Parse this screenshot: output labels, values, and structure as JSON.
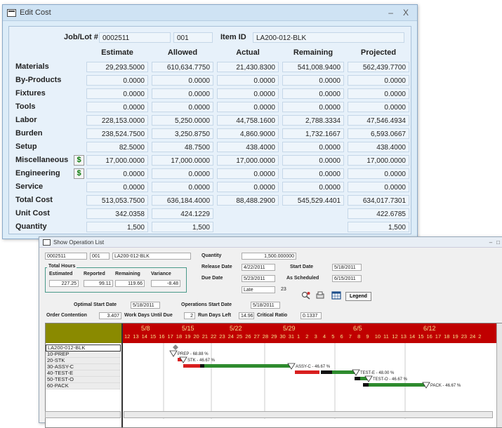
{
  "edit_cost": {
    "title": "Edit Cost",
    "minimize": "–",
    "close": "X",
    "job_lot_label": "Job/Lot #",
    "job": "0002511",
    "lot": "001",
    "item_id_label": "Item ID",
    "item_id": "LA200-012-BLK",
    "columns": [
      "Estimate",
      "Allowed",
      "Actual",
      "Remaining",
      "Projected"
    ],
    "rows": [
      {
        "label": "Materials",
        "values": [
          "29,293.5000",
          "610,634.7750",
          "21,430.8300",
          "541,008.9400",
          "562,439.7700"
        ]
      },
      {
        "label": "By-Products",
        "values": [
          "0.0000",
          "0.0000",
          "0.0000",
          "0.0000",
          "0.0000"
        ]
      },
      {
        "label": "Fixtures",
        "values": [
          "0.0000",
          "0.0000",
          "0.0000",
          "0.0000",
          "0.0000"
        ]
      },
      {
        "label": "Tools",
        "values": [
          "0.0000",
          "0.0000",
          "0.0000",
          "0.0000",
          "0.0000"
        ]
      },
      {
        "label": "Labor",
        "values": [
          "228,153.0000",
          "5,250.0000",
          "44,758.1600",
          "2,788.3334",
          "47,546.4934"
        ]
      },
      {
        "label": "Burden",
        "values": [
          "238,524.7500",
          "3,250.8750",
          "4,860.9000",
          "1,732.1667",
          "6,593.0667"
        ]
      },
      {
        "label": "Setup",
        "values": [
          "82.5000",
          "48.7500",
          "438.4000",
          "0.0000",
          "438.4000"
        ]
      },
      {
        "label": "Miscellaneous",
        "values": [
          "17,000.0000",
          "17,000.0000",
          "17,000.0000",
          "0.0000",
          "17,000.0000"
        ],
        "dollar": true
      },
      {
        "label": "Engineering",
        "values": [
          "0.0000",
          "0.0000",
          "0.0000",
          "0.0000",
          "0.0000"
        ],
        "dollar": true
      },
      {
        "label": "Service",
        "values": [
          "0.0000",
          "0.0000",
          "0.0000",
          "0.0000",
          "0.0000"
        ]
      },
      {
        "label": "Total Cost",
        "values": [
          "513,053.7500",
          "636,184.4000",
          "88,488.2900",
          "545,529.4401",
          "634,017.7301"
        ]
      },
      {
        "label": "Unit Cost",
        "values": [
          "342.0358",
          "424.1229",
          "",
          "",
          "422.6785"
        ]
      },
      {
        "label": "Quantity",
        "values": [
          "1,500",
          "1,500",
          "",
          "",
          "1,500"
        ]
      }
    ],
    "dollar_symbol": "$"
  },
  "operation_list": {
    "title": "Show Operation List",
    "minimize": "–",
    "restore": "□",
    "job": "0002511",
    "lot": "001",
    "item": "LA200-012-BLK",
    "quantity_label": "Quantity",
    "quantity": "1,500.000000",
    "release_date_label": "Release Date",
    "release_date": "4/22/2011",
    "start_date_label": "Start Date",
    "start_date": "5/18/2011",
    "due_date_label": "Due Date",
    "due_date": "5/23/2011",
    "as_scheduled_label": "As Scheduled",
    "as_scheduled": "6/15/2011",
    "status": "Late",
    "status_value": "23",
    "total_hours_label": "Total Hours",
    "hours_headers": [
      "Estimated",
      "Reported",
      "Remaining",
      "Variance"
    ],
    "hours_values": [
      "227.25",
      "99.11",
      "119.66",
      "-8.48"
    ],
    "optimal_start_label": "Optimal Start Date",
    "optimal_start": "5/18/2011",
    "ops_start_label": "Operations Start Date",
    "ops_start": "5/18/2011",
    "order_contention_label": "Order Contention",
    "order_contention": "3.407",
    "work_days_label": "Work Days Until Due",
    "work_days": "2",
    "run_days_label": "Run Days Left",
    "run_days": "14.96",
    "critical_ratio_label": "Critical Ratio",
    "critical_ratio": "0.1337",
    "legend_label": "Legend",
    "weeks": [
      "5/8",
      "5/15",
      "5/22",
      "5/29",
      "6/5",
      "6/12"
    ],
    "days": [
      "12",
      "13",
      "14",
      "15",
      "16",
      "17",
      "18",
      "19",
      "20",
      "21",
      "22",
      "23",
      "24",
      "25",
      "26",
      "27",
      "28",
      "29",
      "30",
      "31",
      "1",
      "2",
      "3",
      "4",
      "5",
      "6",
      "7",
      "8",
      "9",
      "10",
      "11",
      "12",
      "13",
      "14",
      "15",
      "16",
      "17",
      "18",
      "19",
      "23",
      "24",
      "2"
    ],
    "tasks": [
      "LA200-012-BLK",
      "10-PREP",
      "20-STK",
      "30-ASSY-C",
      "40-TEST-E",
      "50-TEST-O",
      "60-PACK"
    ],
    "bar_labels": [
      "PREP - 68.88 %",
      "STK - 46.67 %",
      "ASSY-C - 46.67 %",
      "TEST-E - 48.00 %",
      "TEST-O - 46.67 %",
      "PACK - 46.67 %"
    ],
    "colors": {
      "header_red": "#c00000",
      "header_text": "#f5e08a",
      "olive": "#8a8a00",
      "red_bar": "#d81f1f",
      "green_bar": "#2e8b2e"
    }
  }
}
